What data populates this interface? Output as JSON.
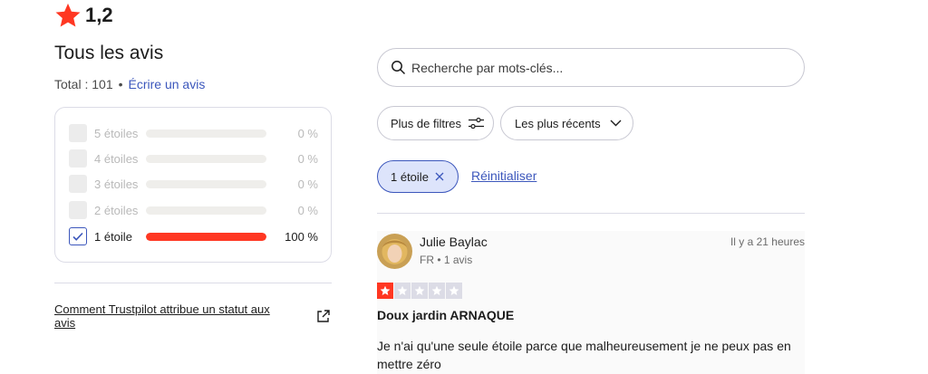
{
  "summary": {
    "score": "1,2",
    "star_icon": "star-icon",
    "accent_color": "#ff3722"
  },
  "reviews_header": {
    "title": "Tous les avis",
    "total_text": "Total : 101",
    "separator": "•",
    "write_link": "Écrire un avis"
  },
  "distribution": [
    {
      "label": "5 étoiles",
      "percent_text": "0 %",
      "fraction": 0,
      "checked": false
    },
    {
      "label": "4 étoiles",
      "percent_text": "0 %",
      "fraction": 0,
      "checked": false
    },
    {
      "label": "3 étoiles",
      "percent_text": "0 %",
      "fraction": 0,
      "checked": false
    },
    {
      "label": "2 étoiles",
      "percent_text": "0 %",
      "fraction": 0,
      "checked": false
    },
    {
      "label": "1 étoile",
      "percent_text": "100 %",
      "fraction": 1,
      "checked": true
    }
  ],
  "trustpilot_link": "Comment Trustpilot attribue un statut aux avis",
  "search": {
    "placeholder": "Recherche par mots-clés..."
  },
  "filters": {
    "more_filters": "Plus de filtres",
    "sort_label": "Les plus récents",
    "active_chip": "1 étoile",
    "reset": "Réinitialiser"
  },
  "review": {
    "author": "Julie Baylac",
    "meta": "FR • 1 avis",
    "date": "Il y a 21 heures",
    "rating": 1,
    "max_rating": 5,
    "title": "Doux jardin ARNAQUE",
    "body": "Je n'ai qu'une seule étoile parce que malheureusement je ne peux pas en mettre zéro"
  }
}
